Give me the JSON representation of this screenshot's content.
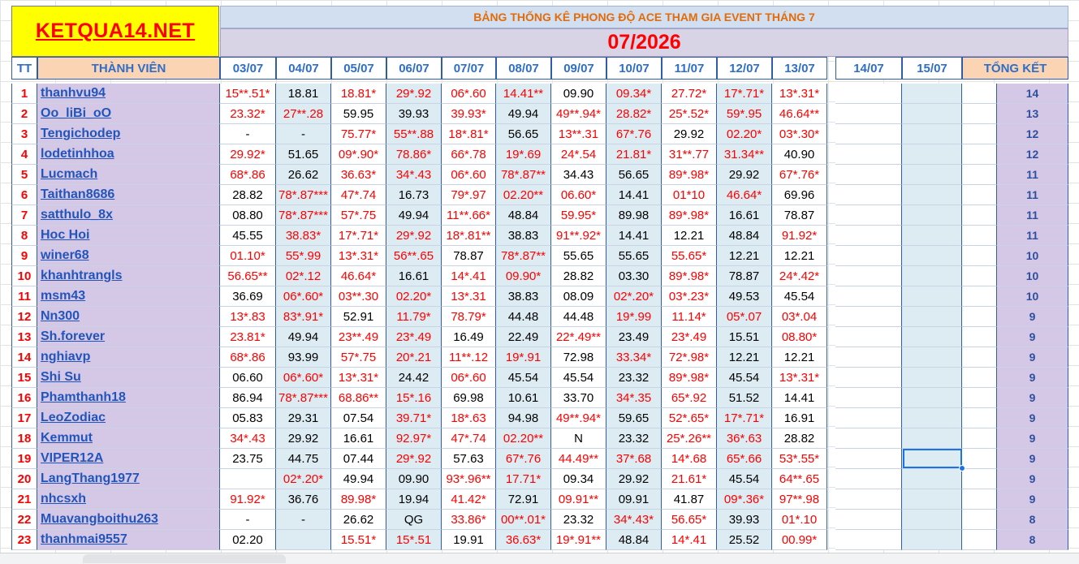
{
  "brand": {
    "label": "KETQUA14.NET"
  },
  "banner": {
    "title": "BẢNG THỐNG KÊ PHONG ĐỘ ACE THAM GIA EVENT THÁNG 7",
    "month": "07/2026"
  },
  "headers": {
    "tt": "TT",
    "member": "THÀNH VIÊN",
    "total": "TỔNG KẾT",
    "dates": [
      "03/07",
      "04/07",
      "05/07",
      "06/07",
      "07/07",
      "08/07",
      "09/07",
      "10/07",
      "11/07",
      "12/07",
      "13/07",
      "14/07",
      "15/07"
    ]
  },
  "rows": [
    {
      "tt": "1",
      "name": "thanhvu94",
      "vals": [
        "15**.51*",
        "18.81",
        "18.81*",
        "29*.92",
        "06*.60",
        "14.41**",
        "09.90",
        "09.34*",
        "27.72*",
        "17*.71*",
        "13*.31*"
      ],
      "total": "14"
    },
    {
      "tt": "2",
      "name": "Oo_liBi_oO",
      "vals": [
        "23.32*",
        "27**.28",
        "59.95",
        "39.93",
        "39.93*",
        "49.94",
        "49**.94*",
        "28.82*",
        "25*.52*",
        "59*.95",
        "46.64**"
      ],
      "total": "13"
    },
    {
      "tt": "3",
      "name": "Tengichodep",
      "vals": [
        "-",
        "-",
        "75.77*",
        "55**.88",
        "18*.81*",
        "56.65",
        "13**.31",
        "67*.76",
        "29.92",
        "02.20*",
        "03*.30*"
      ],
      "total": "12"
    },
    {
      "tt": "4",
      "name": "lodetinhhoa",
      "vals": [
        "29.92*",
        "51.65",
        "09*.90*",
        "78.86*",
        "66*.78",
        "19*.69",
        "24*.54",
        "21.81*",
        "31**.77",
        "31.34**",
        "40.90"
      ],
      "total": "12"
    },
    {
      "tt": "5",
      "name": "Lucmach",
      "vals": [
        "68*.86",
        "26.62",
        "36.63*",
        "34*.43",
        "06*.60",
        "78*.87**",
        "34.43",
        "56.65",
        "89*.98*",
        "29.92",
        "67*.76*"
      ],
      "total": "11"
    },
    {
      "tt": "6",
      "name": "Taithan8686",
      "vals": [
        "28.82",
        "78*.87***",
        "47*.74",
        "16.73",
        "79*.97",
        "02.20**",
        "06.60*",
        "14.41",
        "01*10",
        "46.64*",
        "69.96"
      ],
      "total": "11"
    },
    {
      "tt": "7",
      "name": "satthulo_8x",
      "vals": [
        "08.80",
        "78*.87***",
        "57*.75",
        "49.94",
        "11**.66*",
        "48.84",
        "59.95*",
        "89.98",
        "89*.98*",
        "16.61",
        "78.87"
      ],
      "total": "11"
    },
    {
      "tt": "8",
      "name": "Hoc Hoi",
      "vals": [
        "45.55",
        "38.83*",
        "17*.71*",
        "29*.92",
        "18*.81**",
        "38.83",
        "91**.92*",
        "14.41",
        "12.21",
        "48.84",
        "91.92*"
      ],
      "total": "11"
    },
    {
      "tt": "9",
      "name": "winer68",
      "vals": [
        "01.10*",
        "55*.99",
        "13*.31*",
        "56**.65",
        "78.87",
        "78*.87**",
        "55.65",
        "55.65",
        "55.65*",
        "12.21",
        "12.21"
      ],
      "total": "10"
    },
    {
      "tt": "10",
      "name": "khanhtrangls",
      "vals": [
        "56.65**",
        "02*.12",
        "46.64*",
        "16.61",
        "14*.41",
        "09.90*",
        "28.82",
        "03.30",
        "89*.98*",
        "78.87",
        "24*.42*"
      ],
      "total": "10"
    },
    {
      "tt": "11",
      "name": "msm43",
      "vals": [
        "36.69",
        "06*.60*",
        "03**.30",
        "02.20*",
        "13*.31",
        "38.83",
        "08.09",
        "02*.20*",
        "03*.23*",
        "49.53",
        "45.54"
      ],
      "total": "10"
    },
    {
      "tt": "12",
      "name": "Nn300",
      "vals": [
        "13*.83",
        "83*.91*",
        "52.91",
        "11.79*",
        "78.79*",
        "44.48",
        "44.48",
        "19*.99",
        "11.14*",
        "05*.07",
        "03*.04"
      ],
      "total": "9"
    },
    {
      "tt": "13",
      "name": "Sh.forever",
      "vals": [
        "23.81*",
        "49.94",
        "23**.49",
        "23*.49",
        "16.49",
        "22.49",
        "22*.49**",
        "23.49",
        "23*.49",
        "15.51",
        "08.80*"
      ],
      "total": "9"
    },
    {
      "tt": "14",
      "name": "nghiavp",
      "vals": [
        "68*.86",
        "93.99",
        "57*.75",
        "20*.21",
        "11**.12",
        "19*.91",
        "72.98",
        "33.34*",
        "72*.98*",
        "12.21",
        "12.21"
      ],
      "total": "9"
    },
    {
      "tt": "15",
      "name": "Shi Su",
      "vals": [
        "06.60",
        "06*.60*",
        "13*.31*",
        "24.42",
        "06*.60",
        "45.54",
        "45.54",
        "23.32",
        "89*.98*",
        "45.54",
        "13*.31*"
      ],
      "total": "9"
    },
    {
      "tt": "16",
      "name": "Phamthanh18",
      "vals": [
        "86.94",
        "78*.87***",
        "68.86**",
        "15*.16",
        "69.98",
        "10.61",
        "33.70",
        "34*.35",
        "65*.92",
        "51.52",
        "14.41"
      ],
      "total": "9"
    },
    {
      "tt": "17",
      "name": "LeoZodiac",
      "vals": [
        "05.83",
        "29.31",
        "07.54",
        "39.71*",
        "18*.63",
        "94.98",
        "49**.94*",
        "59.65",
        "52*.65*",
        "17*.71*",
        "16.91"
      ],
      "total": "9"
    },
    {
      "tt": "18",
      "name": "Kemmut",
      "vals": [
        "34*.43",
        "29.92",
        "16.61",
        "92.97*",
        "47*.74",
        "02.20**",
        "N",
        "23.32",
        "25*.26**",
        "36*.63",
        "28.82"
      ],
      "total": "9"
    },
    {
      "tt": "19",
      "name": "VIPER12A",
      "vals": [
        "23.75",
        "44.75",
        "07.44",
        "29*.92",
        "57.63",
        "67*.76",
        "44.49**",
        "37*.68",
        "14*.68",
        "65*.66",
        "53*.55*"
      ],
      "total": "9"
    },
    {
      "tt": "20",
      "name": "LangThang1977",
      "vals": [
        "",
        "02*.20*",
        "49.94",
        "09.90",
        "93*.96**",
        "17.71*",
        "09.34",
        "29.92",
        "21.61*",
        "45.54",
        "64**.65"
      ],
      "total": "9"
    },
    {
      "tt": "21",
      "name": "nhcsxh",
      "vals": [
        "91.92*",
        "36.76",
        "89.98*",
        "19.94",
        "41.42*",
        "72.91",
        "09.91**",
        "09.91",
        "41.87",
        "09*.36*",
        "97**.98"
      ],
      "total": "9"
    },
    {
      "tt": "22",
      "name": "Muavangboithu263",
      "vals": [
        "-",
        "-",
        "26.62",
        "QG",
        "33.86*",
        "00**.01*",
        "23.32",
        "34*.43*",
        "56.65*",
        "39.93",
        "01*.10"
      ],
      "total": "8"
    },
    {
      "tt": "23",
      "name": "thanhmai9557",
      "vals": [
        "02.20",
        "",
        "15.51*",
        "15*.51",
        "19.91",
        "36.63*",
        "19*.91**",
        "48.84",
        "14*.41",
        "25.52",
        "00.99*"
      ],
      "total": "8"
    }
  ]
}
